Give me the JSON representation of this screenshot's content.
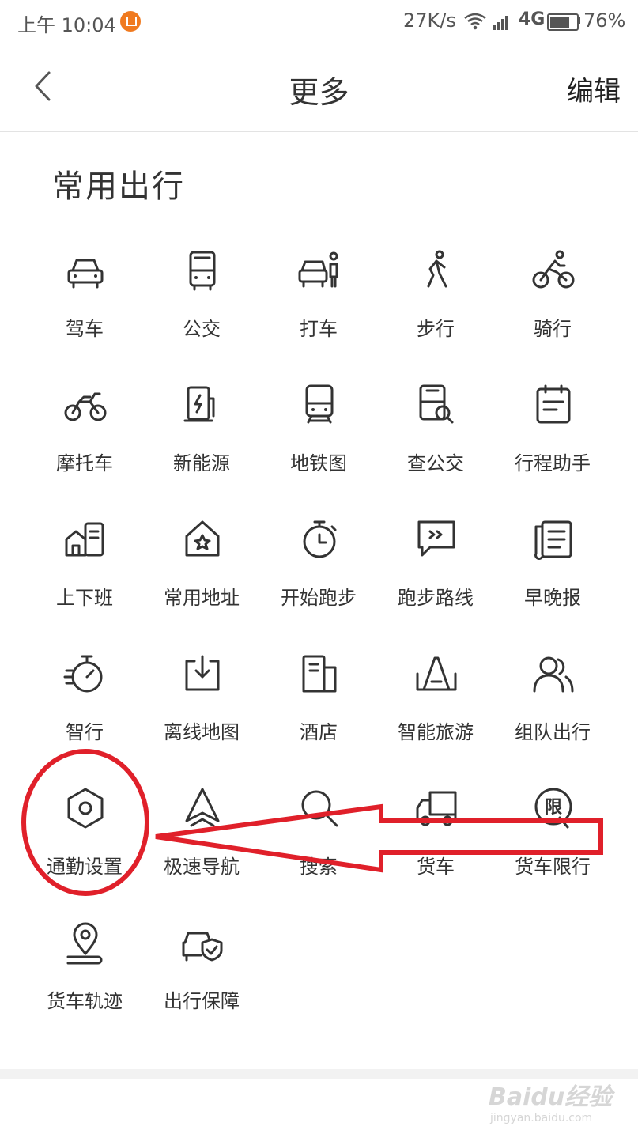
{
  "status_bar": {
    "time": "上午 10:04",
    "speed": "27K/s",
    "network": "4G",
    "battery_percent": "76%",
    "battery_level": 0.76
  },
  "header": {
    "title": "更多",
    "edit_label": "编辑"
  },
  "section": {
    "title": "常用出行"
  },
  "items": [
    {
      "label": "驾车",
      "icon": "car-icon"
    },
    {
      "label": "公交",
      "icon": "bus-icon"
    },
    {
      "label": "打车",
      "icon": "taxi-icon"
    },
    {
      "label": "步行",
      "icon": "walk-icon"
    },
    {
      "label": "骑行",
      "icon": "cycling-icon"
    },
    {
      "label": "摩托车",
      "icon": "motorcycle-icon"
    },
    {
      "label": "新能源",
      "icon": "ev-charger-icon"
    },
    {
      "label": "地铁图",
      "icon": "subway-icon"
    },
    {
      "label": "查公交",
      "icon": "bus-search-icon"
    },
    {
      "label": "行程助手",
      "icon": "trip-assistant-icon"
    },
    {
      "label": "上下班",
      "icon": "commute-icon"
    },
    {
      "label": "常用地址",
      "icon": "home-star-icon"
    },
    {
      "label": "开始跑步",
      "icon": "stopwatch-icon"
    },
    {
      "label": "跑步路线",
      "icon": "running-route-icon"
    },
    {
      "label": "早晚报",
      "icon": "newspaper-icon"
    },
    {
      "label": "智行",
      "icon": "smart-travel-icon"
    },
    {
      "label": "离线地图",
      "icon": "offline-map-icon"
    },
    {
      "label": "酒店",
      "icon": "hotel-icon"
    },
    {
      "label": "智能旅游",
      "icon": "tourism-icon"
    },
    {
      "label": "组队出行",
      "icon": "group-travel-icon"
    },
    {
      "label": "通勤设置",
      "icon": "hexagon-settings-icon"
    },
    {
      "label": "极速导航",
      "icon": "navigation-arrow-icon"
    },
    {
      "label": "搜索",
      "icon": "search-icon"
    },
    {
      "label": "货车",
      "icon": "truck-icon"
    },
    {
      "label": "货车限行",
      "icon": "truck-restriction-icon"
    },
    {
      "label": "货车轨迹",
      "icon": "truck-track-icon"
    },
    {
      "label": "出行保障",
      "icon": "travel-protection-icon"
    }
  ],
  "annotation_colors": {
    "highlight": "#e0202a"
  },
  "watermark": {
    "main": "Baidu经验",
    "sub": "jingyan.baidu.com"
  }
}
